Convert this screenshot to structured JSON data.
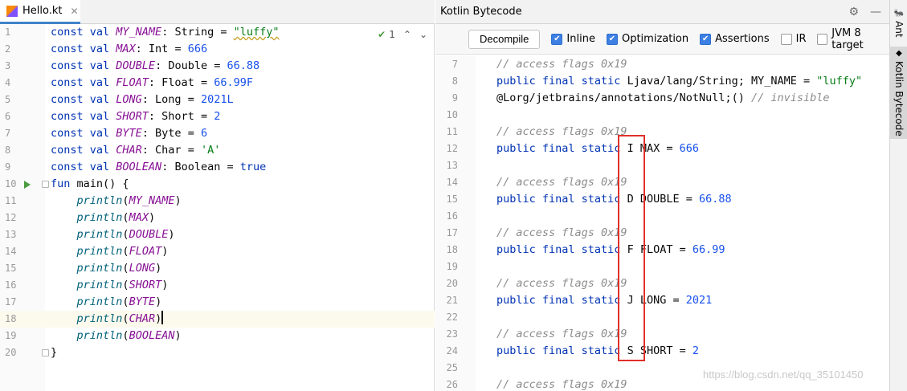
{
  "left": {
    "tab_label": "Hello.kt",
    "inspection_count": "1",
    "lines": [
      [
        [
          "kw",
          "const val "
        ],
        [
          "cst",
          "MY_NAME"
        ],
        [
          "pln",
          ": String = "
        ],
        [
          "str",
          "\"luffy\""
        ]
      ],
      [
        [
          "kw",
          "const val "
        ],
        [
          "cst",
          "MAX"
        ],
        [
          "pln",
          ": Int = "
        ],
        [
          "num",
          "666"
        ]
      ],
      [
        [
          "kw",
          "const val "
        ],
        [
          "cst",
          "DOUBLE"
        ],
        [
          "pln",
          ": Double = "
        ],
        [
          "num",
          "66.88"
        ]
      ],
      [
        [
          "kw",
          "const val "
        ],
        [
          "cst",
          "FLOAT"
        ],
        [
          "pln",
          ": Float = "
        ],
        [
          "num",
          "66.99F"
        ]
      ],
      [
        [
          "kw",
          "const val "
        ],
        [
          "cst",
          "LONG"
        ],
        [
          "pln",
          ": Long = "
        ],
        [
          "num",
          "2021L"
        ]
      ],
      [
        [
          "kw",
          "const val "
        ],
        [
          "cst",
          "SHORT"
        ],
        [
          "pln",
          ": Short = "
        ],
        [
          "num",
          "2"
        ]
      ],
      [
        [
          "kw",
          "const val "
        ],
        [
          "cst",
          "BYTE"
        ],
        [
          "pln",
          ": Byte = "
        ],
        [
          "num",
          "6"
        ]
      ],
      [
        [
          "kw",
          "const val "
        ],
        [
          "cst",
          "CHAR"
        ],
        [
          "pln",
          ": Char = "
        ],
        [
          "str",
          "'A'"
        ]
      ],
      [
        [
          "kw",
          "const val "
        ],
        [
          "cst",
          "BOOLEAN"
        ],
        [
          "pln",
          ": Boolean = "
        ],
        [
          "kw",
          "true"
        ]
      ],
      [
        [
          "kw",
          "fun "
        ],
        [
          "pln",
          "main() {"
        ]
      ],
      [
        [
          "pln",
          "    "
        ],
        [
          "fnc ital",
          "println"
        ],
        [
          "pln",
          "("
        ],
        [
          "cst",
          "MY_NAME"
        ],
        [
          "pln",
          ")"
        ]
      ],
      [
        [
          "pln",
          "    "
        ],
        [
          "fnc ital",
          "println"
        ],
        [
          "pln",
          "("
        ],
        [
          "cst",
          "MAX"
        ],
        [
          "pln",
          ")"
        ]
      ],
      [
        [
          "pln",
          "    "
        ],
        [
          "fnc ital",
          "println"
        ],
        [
          "pln",
          "("
        ],
        [
          "cst",
          "DOUBLE"
        ],
        [
          "pln",
          ")"
        ]
      ],
      [
        [
          "pln",
          "    "
        ],
        [
          "fnc ital",
          "println"
        ],
        [
          "pln",
          "("
        ],
        [
          "cst",
          "FLOAT"
        ],
        [
          "pln",
          ")"
        ]
      ],
      [
        [
          "pln",
          "    "
        ],
        [
          "fnc ital",
          "println"
        ],
        [
          "pln",
          "("
        ],
        [
          "cst",
          "LONG"
        ],
        [
          "pln",
          ")"
        ]
      ],
      [
        [
          "pln",
          "    "
        ],
        [
          "fnc ital",
          "println"
        ],
        [
          "pln",
          "("
        ],
        [
          "cst",
          "SHORT"
        ],
        [
          "pln",
          ")"
        ]
      ],
      [
        [
          "pln",
          "    "
        ],
        [
          "fnc ital",
          "println"
        ],
        [
          "pln",
          "("
        ],
        [
          "cst",
          "BYTE"
        ],
        [
          "pln",
          ")"
        ]
      ],
      [
        [
          "pln",
          "    "
        ],
        [
          "fnc ital",
          "println"
        ],
        [
          "pln",
          "("
        ],
        [
          "cst",
          "CHAR"
        ],
        [
          "pln",
          ")"
        ]
      ],
      [
        [
          "pln",
          "    "
        ],
        [
          "fnc ital",
          "println"
        ],
        [
          "pln",
          "("
        ],
        [
          "cst",
          "BOOLEAN"
        ],
        [
          "pln",
          ")"
        ]
      ],
      [
        [
          "pln",
          "}"
        ]
      ]
    ],
    "line_numbers": [
      "1",
      "2",
      "3",
      "4",
      "5",
      "6",
      "7",
      "8",
      "9",
      "10",
      "11",
      "12",
      "13",
      "14",
      "15",
      "16",
      "17",
      "18",
      "19",
      "20"
    ],
    "current_line": 18
  },
  "right": {
    "title": "Kotlin Bytecode",
    "decompile_label": "Decompile",
    "options": [
      {
        "label": "Inline",
        "checked": true
      },
      {
        "label": "Optimization",
        "checked": true
      },
      {
        "label": "Assertions",
        "checked": true
      },
      {
        "label": "IR",
        "checked": false
      },
      {
        "label": "JVM 8 target",
        "checked": false
      }
    ],
    "line_numbers": [
      "7",
      "8",
      "9",
      "10",
      "11",
      "12",
      "13",
      "14",
      "15",
      "16",
      "17",
      "18",
      "19",
      "20",
      "21",
      "22",
      "23",
      "24",
      "25",
      "26"
    ],
    "lines": [
      [
        [
          "cmt",
          "// access flags 0x19"
        ]
      ],
      [
        [
          "kw",
          "public final static "
        ],
        [
          "pln",
          "Ljava/lang/String; MY_NAME = "
        ],
        [
          "str",
          "\"luffy\""
        ]
      ],
      [
        [
          "pln",
          "@Lorg/jetbrains/annotations/NotNull;() "
        ],
        [
          "cmt",
          "// invisible"
        ]
      ],
      [],
      [
        [
          "cmt",
          "// access flags 0x19"
        ]
      ],
      [
        [
          "kw",
          "public final static "
        ],
        [
          "pln",
          "I MAX = "
        ],
        [
          "num",
          "666"
        ]
      ],
      [],
      [
        [
          "cmt",
          "// access flags 0x19"
        ]
      ],
      [
        [
          "kw",
          "public final static "
        ],
        [
          "pln",
          "D DOUBLE = "
        ],
        [
          "num",
          "66.88"
        ]
      ],
      [],
      [
        [
          "cmt",
          "// access flags 0x19"
        ]
      ],
      [
        [
          "kw",
          "public final static "
        ],
        [
          "pln",
          "F FLOAT = "
        ],
        [
          "num",
          "66.99"
        ]
      ],
      [],
      [
        [
          "cmt",
          "// access flags 0x19"
        ]
      ],
      [
        [
          "kw",
          "public final static "
        ],
        [
          "pln",
          "J LONG = "
        ],
        [
          "num",
          "2021"
        ]
      ],
      [],
      [
        [
          "cmt",
          "// access flags 0x19"
        ]
      ],
      [
        [
          "kw",
          "public final static "
        ],
        [
          "pln",
          "S SHORT = "
        ],
        [
          "num",
          "2"
        ]
      ],
      [],
      [
        [
          "cmt",
          "// access flags 0x19"
        ]
      ]
    ]
  },
  "stripe": {
    "ant_label": "Ant",
    "bytecode_label": "Kotlin Bytecode"
  },
  "watermark": "https://blog.csdn.net/qq_35101450"
}
